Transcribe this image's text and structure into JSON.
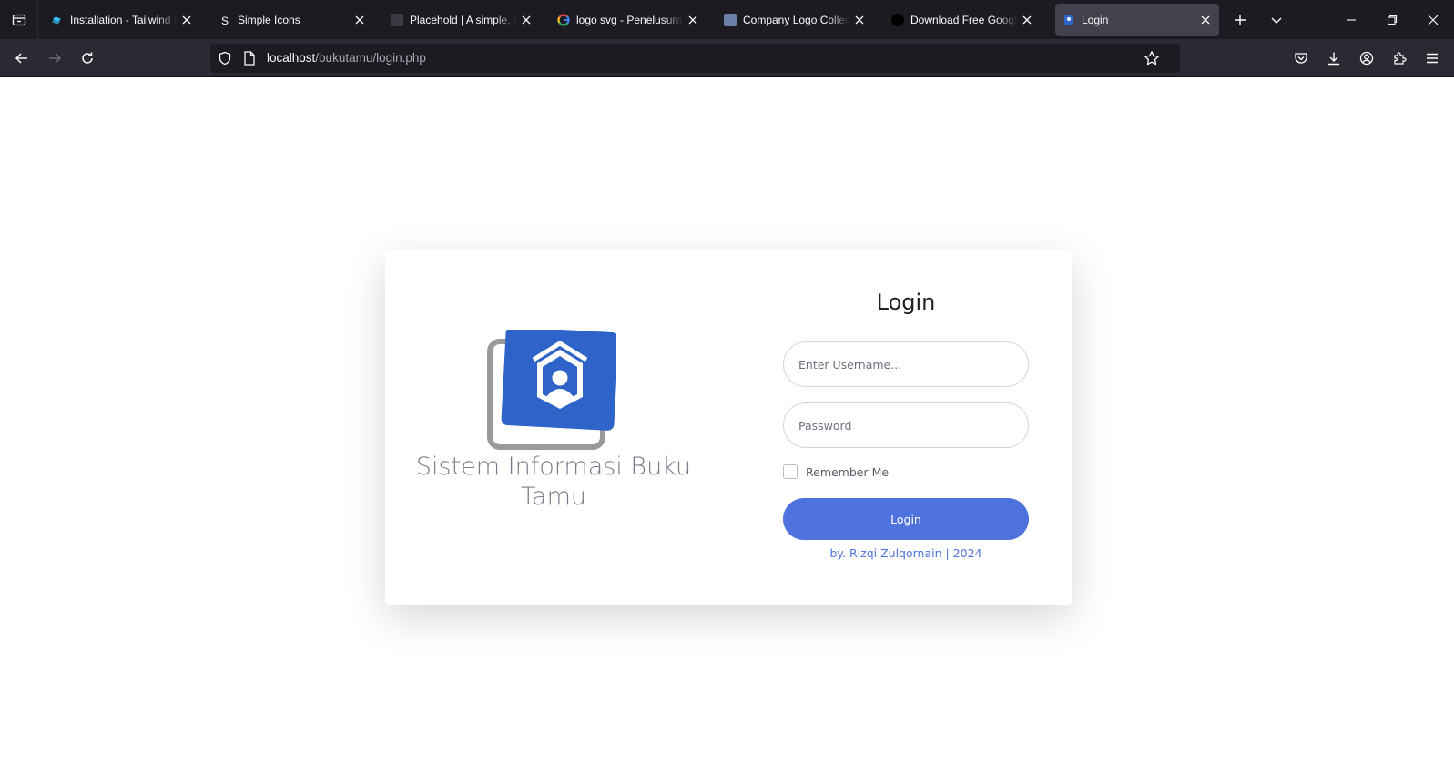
{
  "browser": {
    "tabs": [
      {
        "title": "Installation - Tailwind CSS",
        "favicon": "tailwind-icon",
        "active": false
      },
      {
        "title": "Simple Icons",
        "favicon": "simple-icons-icon",
        "active": false
      },
      {
        "title": "Placehold | A simple, fast placeholder image service",
        "favicon": "placehold-icon",
        "active": false
      },
      {
        "title": "logo svg - Penelusuran Google",
        "favicon": "google-icon",
        "active": false
      },
      {
        "title": "Company Logo Collection",
        "favicon": "svgrepo-icon",
        "active": false
      },
      {
        "title": "Download Free Google Fonts",
        "favicon": "fonts-icon",
        "active": false
      },
      {
        "title": "Login",
        "favicon": "bukutamu-icon",
        "active": true
      }
    ],
    "url_host": "localhost",
    "url_path": "/bukutamu/login.php"
  },
  "page": {
    "brand_title": "Sistem Informasi Buku Tamu",
    "brand_color": "#2e63c9",
    "login_title": "Login",
    "username_placeholder": "Enter Username...",
    "password_placeholder": "Password",
    "remember_label": "Remember Me",
    "login_button": "Login",
    "credit": "by. Rizqi Zulqornain | 2024",
    "accent_color": "#4e73df"
  }
}
